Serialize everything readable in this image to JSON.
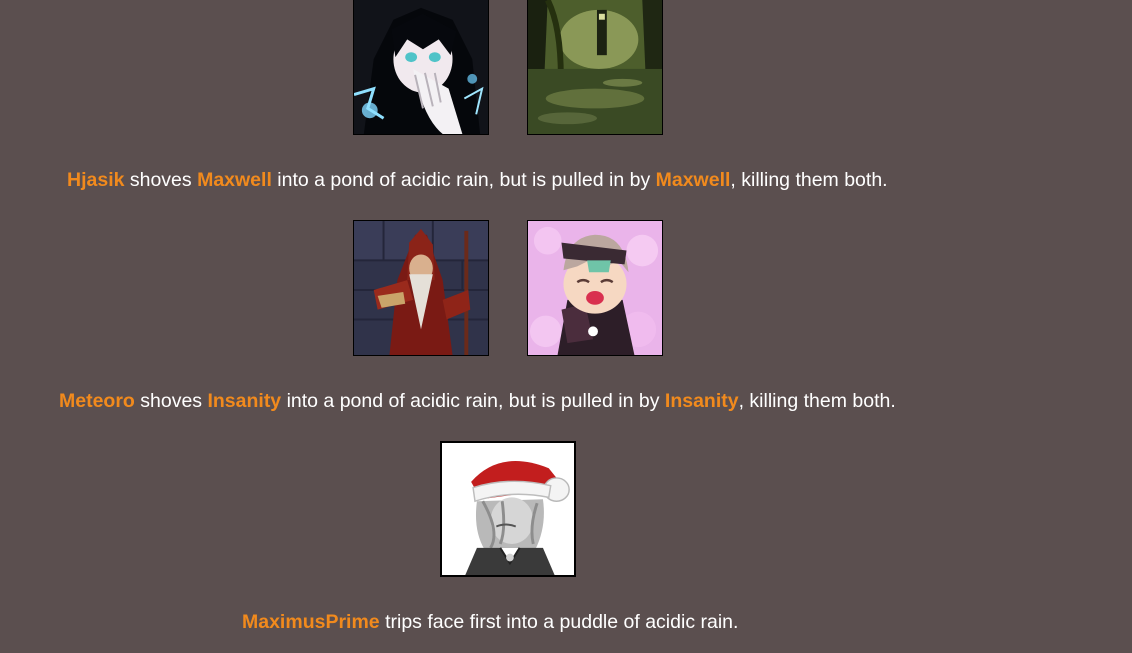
{
  "colors": {
    "background": "#5b4f4f",
    "tribute_name": "#f18a1d",
    "text": "#ffffff"
  },
  "events": [
    {
      "avatars": [
        {
          "icon": "dark-haired-anime-girl-portrait"
        },
        {
          "icon": "swamp-forest-tower-landscape"
        }
      ],
      "parts": {
        "actor": "Hjasik",
        "t1": " shoves ",
        "target": "Maxwell",
        "t2": " into a pond of acidic rain, but is pulled in by ",
        "target2": "Maxwell",
        "t3": ", killing them both."
      }
    },
    {
      "avatars": [
        {
          "icon": "bearded-wizard-red-robe-portrait"
        },
        {
          "icon": "chibi-anime-girl-pink-background-portrait"
        }
      ],
      "parts": {
        "actor": "Meteoro",
        "t1": " shoves ",
        "target": "Insanity",
        "t2": " into a pond of acidic rain, but is pulled in by ",
        "target2": "Insanity",
        "t3": ", killing them both."
      }
    },
    {
      "avatars": [
        {
          "icon": "gray-haired-character-santa-hat-portrait"
        }
      ],
      "parts": {
        "actor": "MaximusPrime",
        "t1": " trips face first into a puddle of acidic rain."
      }
    }
  ]
}
